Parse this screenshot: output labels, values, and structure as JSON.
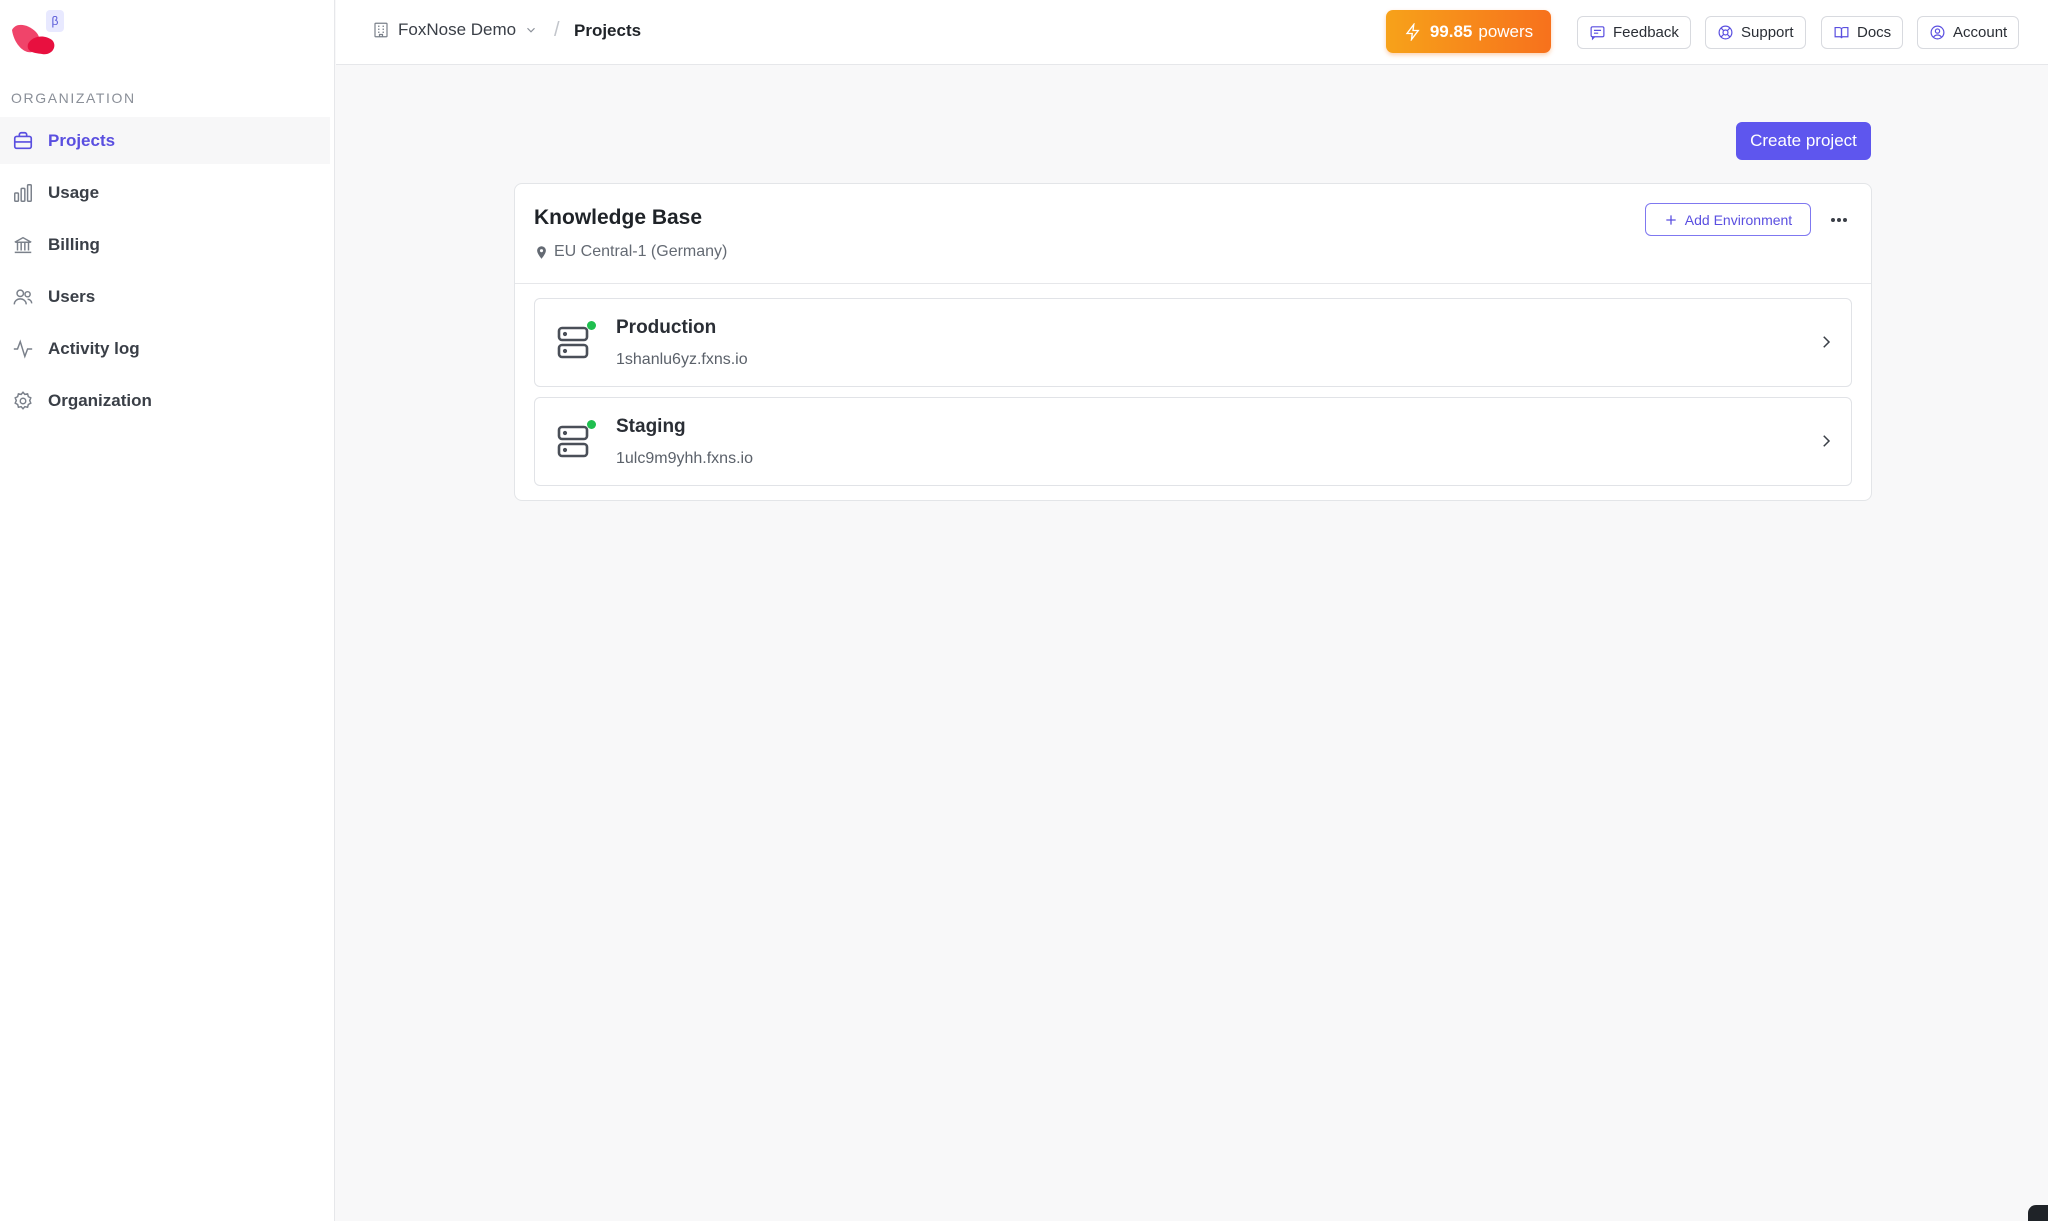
{
  "sidebar": {
    "beta_badge": "β",
    "section_label": "ORGANIZATION",
    "items": [
      {
        "label": "Projects",
        "icon": "briefcase-icon",
        "active": true
      },
      {
        "label": "Usage",
        "icon": "bar-chart-icon"
      },
      {
        "label": "Billing",
        "icon": "bank-icon"
      },
      {
        "label": "Users",
        "icon": "users-icon"
      },
      {
        "label": "Activity log",
        "icon": "activity-icon"
      },
      {
        "label": "Organization",
        "icon": "gear-icon"
      }
    ]
  },
  "topbar": {
    "org_name": "FoxNose Demo",
    "separator": "/",
    "current": "Projects",
    "powers_value": "99.85",
    "powers_unit": "powers",
    "buttons": {
      "feedback": "Feedback",
      "support": "Support",
      "docs": "Docs",
      "account": "Account"
    }
  },
  "main": {
    "create_label": "Create project",
    "project": {
      "title": "Knowledge Base",
      "region": "EU Central-1 (Germany)",
      "add_env_label": "Add Environment",
      "environments": [
        {
          "name": "Production",
          "host": "1shanlu6yz.fxns.io",
          "status": "online"
        },
        {
          "name": "Staging",
          "host": "1ulc9m9yhh.fxns.io",
          "status": "online"
        }
      ]
    }
  },
  "colors": {
    "accent": "#5e56ee",
    "status_online": "#1fbf4f",
    "powers_start": "#f7a21a",
    "powers_end": "#f7711c"
  }
}
